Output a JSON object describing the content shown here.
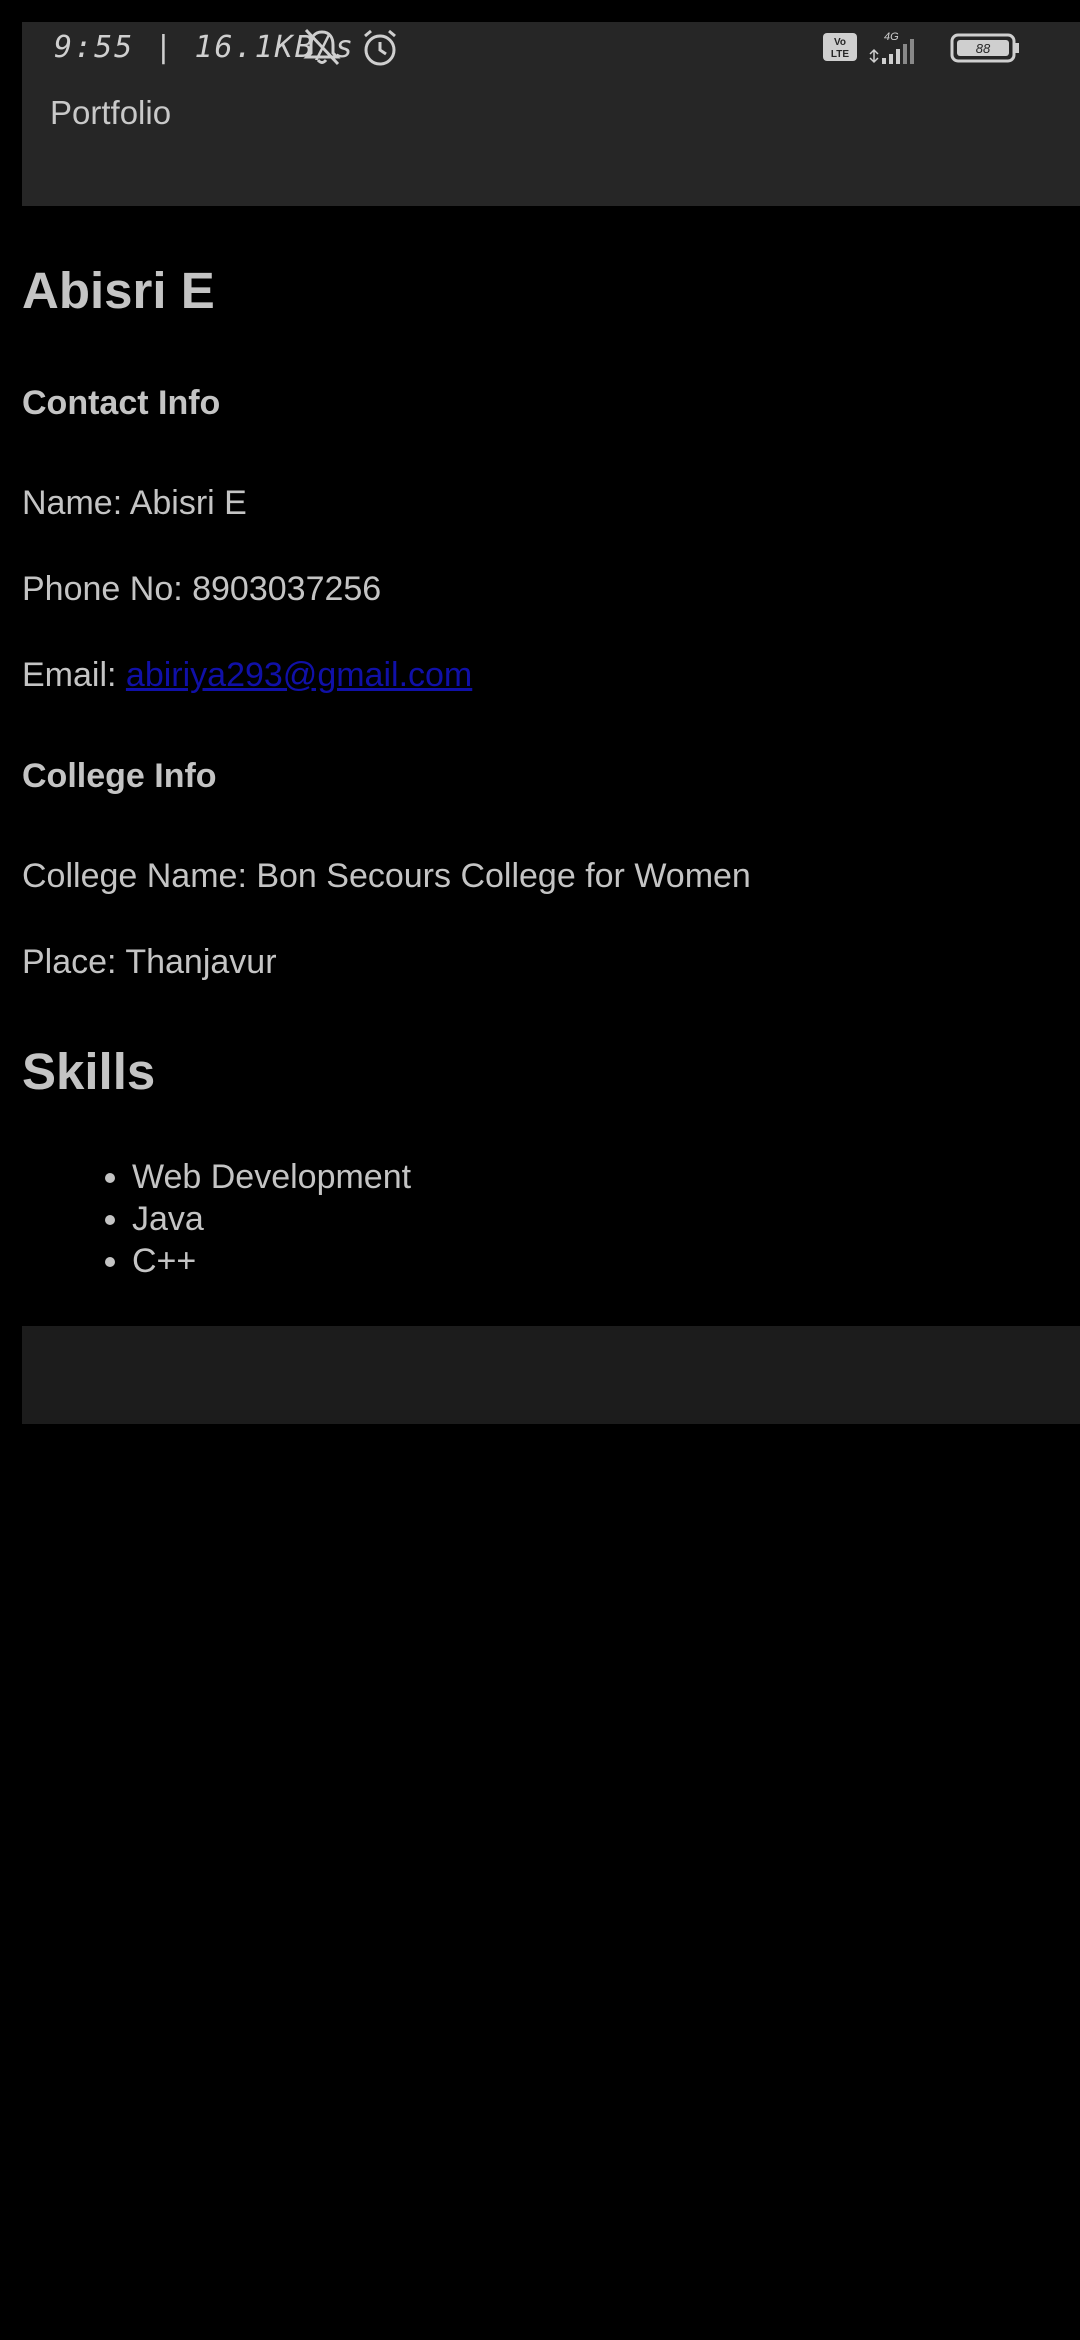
{
  "status_bar": {
    "time": "9:55",
    "speed": "16.1KB/s",
    "network": "4G",
    "volte": "Vo LTE",
    "battery": "88"
  },
  "app_bar": {
    "title": "Portfolio"
  },
  "profile": {
    "name_heading": "Abisri E",
    "contact_heading": "Contact Info",
    "name_line": "Name: Abisri E",
    "phone_line": "Phone No: 8903037256",
    "email_label": "Email: ",
    "email_link": "abiriya293@gmail.com",
    "college_heading": "College Info",
    "college_line": "College Name: Bon Secours College for Women",
    "place_line": "Place: Thanjavur"
  },
  "skills": {
    "heading": "Skills",
    "items": [
      "Web Development",
      "Java",
      "C++"
    ]
  },
  "colors": {
    "app_bar_bg": "#262626",
    "background": "#000000",
    "link": "#1010a8",
    "text": "#c4c4c4"
  }
}
